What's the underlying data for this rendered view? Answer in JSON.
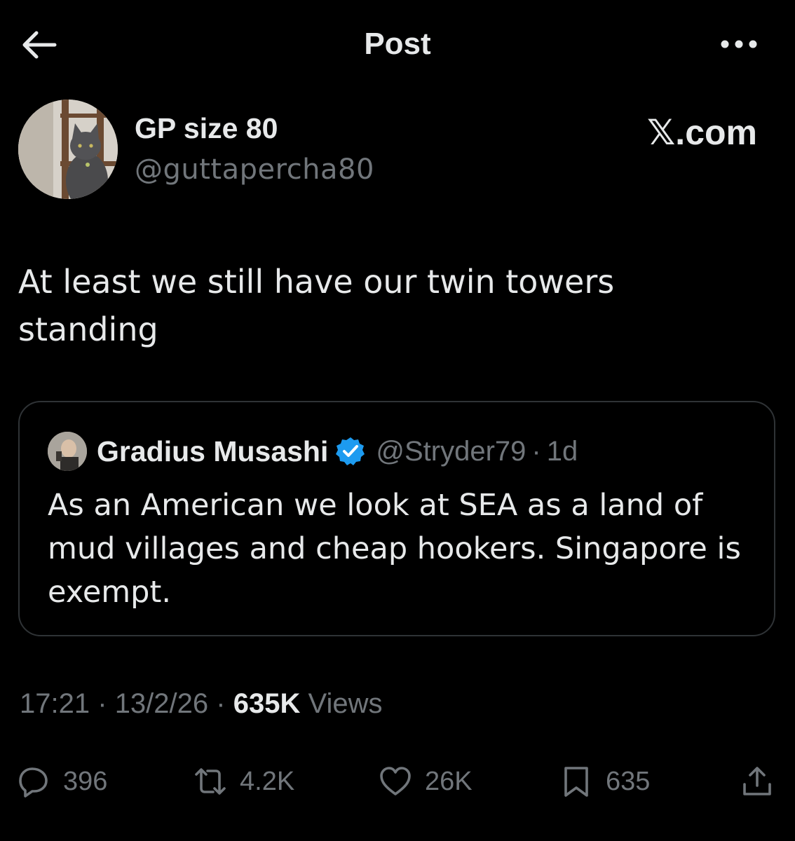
{
  "header": {
    "title": "Post",
    "back_icon": "arrow-left-icon",
    "more_icon": "more-horizontal-icon"
  },
  "author": {
    "name": "GP size 80",
    "handle": "@guttapercha80",
    "source": "𝕏.com"
  },
  "post": {
    "text": "At least we still have our twin towers standing"
  },
  "quote": {
    "name": "Gradius Musashi",
    "handle": "@Stryder79",
    "dot": "·",
    "time": "1d",
    "verified_color": "#1d9bf0",
    "text": "As an American we look at SEA as a land of mud villages and cheap hookers. Singapore is exempt."
  },
  "meta": {
    "time": "17:21",
    "sep1": "·",
    "date": "13/2/26",
    "sep2": "·",
    "views_count": "635K",
    "views_label": "Views"
  },
  "actions": {
    "replies": "396",
    "reposts": "4.2K",
    "likes": "26K",
    "bookmarks": "635"
  },
  "colors": {
    "background": "#000000",
    "text": "#e7e9ea",
    "muted": "#71767b",
    "border": "#2f3336"
  }
}
